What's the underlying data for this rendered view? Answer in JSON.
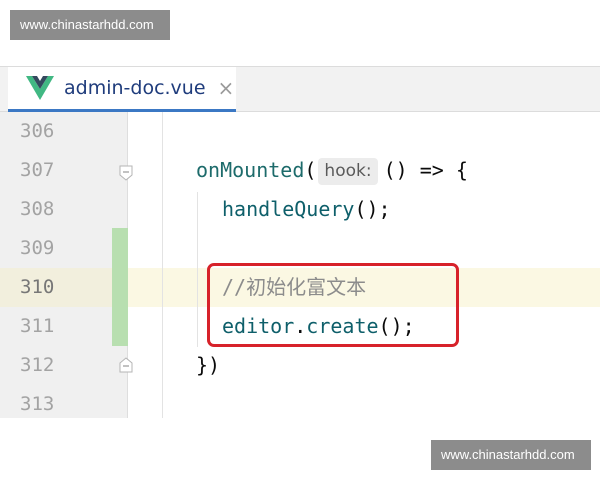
{
  "watermarks": {
    "top": "www.chinastarhdd.com",
    "bottom": "www.chinastarhdd.com"
  },
  "tab": {
    "icon": "vue-logo-icon",
    "file_name": "admin-doc.vue",
    "close_glyph": "×",
    "accent_color": "#3b78c4"
  },
  "editor": {
    "current_line": "310",
    "lines": [
      {
        "number": "306",
        "code": ""
      },
      {
        "number": "307",
        "fn": "onMounted",
        "open_paren": "(",
        "hint": "hook:",
        "rest": "() => {"
      },
      {
        "number": "308",
        "fn": "handleQuery",
        "rest": "();"
      },
      {
        "number": "309",
        "code": ""
      },
      {
        "number": "310",
        "comment": "//初始化富文本"
      },
      {
        "number": "311",
        "obj": "editor",
        "dot": ".",
        "fn": "create",
        "rest": "();"
      },
      {
        "number": "312",
        "code": "})"
      },
      {
        "number": "313",
        "code": ""
      }
    ]
  },
  "colors": {
    "highlight_box": "#d7222a",
    "change_marker": "#b8dfb0",
    "current_line_bg": "#fbf8e3"
  }
}
